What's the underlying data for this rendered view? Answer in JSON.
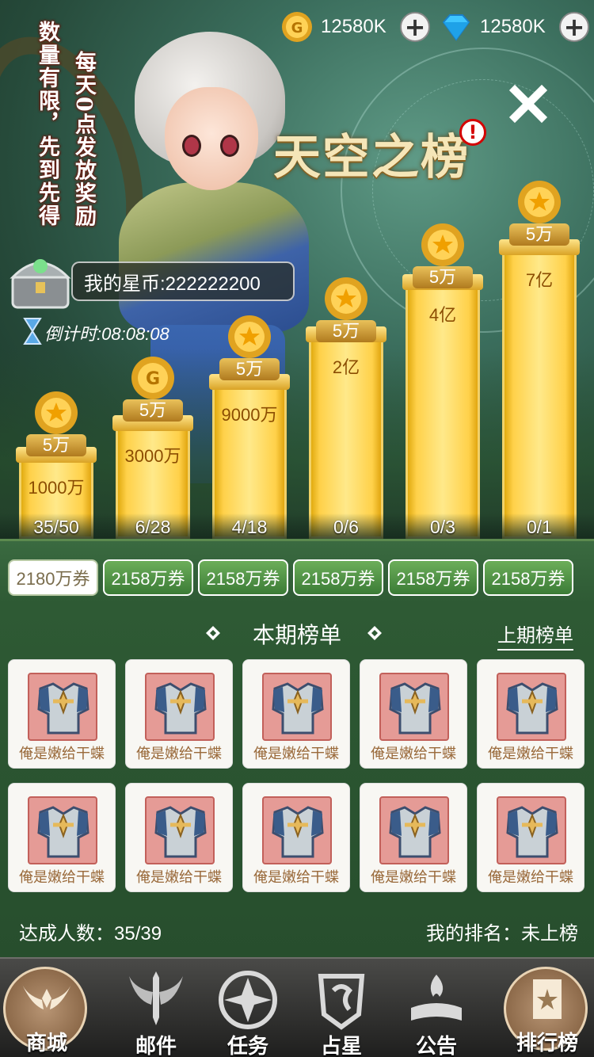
{
  "currencies": [
    {
      "amount": "12580K"
    },
    {
      "amount": "12580K"
    }
  ],
  "notice": {
    "col1": "数量有限，先到先得",
    "col2": "每天0点发放奖励"
  },
  "title": "天空之榜",
  "alert_mark": "!",
  "my_stars": "我的星币:222222200",
  "countdown": {
    "label": "倒计时:",
    "time": "08:08:08"
  },
  "tiers": [
    {
      "reward": "5万",
      "value": "1000万",
      "progress": "35/50"
    },
    {
      "reward": "5万",
      "value": "3000万",
      "progress": "6/28"
    },
    {
      "reward": "5万",
      "value": "9000万",
      "progress": "4/18"
    },
    {
      "reward": "5万",
      "value": "2亿",
      "progress": "0/6"
    },
    {
      "reward": "5万",
      "value": "4亿",
      "progress": "0/3"
    },
    {
      "reward": "5万",
      "value": "7亿",
      "progress": "0/1"
    }
  ],
  "tabs": [
    "2180万券",
    "2158万券",
    "2158万券",
    "2158万券",
    "2158万券",
    "2158万券"
  ],
  "section_title": "本期榜单",
  "prev_link": "上期榜单",
  "ranking_items": [
    "俺是嫩给干蝶",
    "俺是嫩给干蝶",
    "俺是嫩给干蝶",
    "俺是嫩给干蝶",
    "俺是嫩给干蝶",
    "俺是嫩给干蝶",
    "俺是嫩给干蝶",
    "俺是嫩给干蝶",
    "俺是嫩给干蝶",
    "俺是嫩给干蝶"
  ],
  "stats": {
    "achieved": "达成人数：35/39",
    "my_rank": "我的排名：未上榜"
  },
  "nav": [
    "商城",
    "邮件",
    "任务",
    "占星",
    "公告",
    "排行榜"
  ],
  "colors": {
    "bar_value": "#8b4d02",
    "active_tab_text": "#7a6d4d",
    "item_name": "#9a6a3b",
    "gold": "#ffeac6"
  }
}
